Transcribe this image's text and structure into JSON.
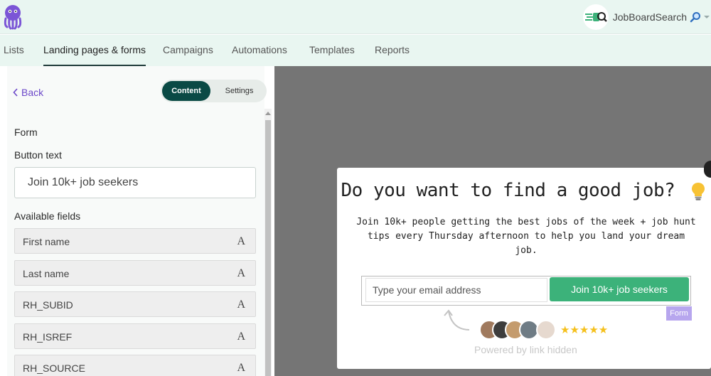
{
  "account": {
    "name": "JobBoardSearch"
  },
  "nav": {
    "tabs": [
      "Lists",
      "Landing pages & forms",
      "Campaigns",
      "Automations",
      "Templates",
      "Reports"
    ],
    "active": "Landing pages & forms"
  },
  "panel": {
    "back_label": "Back",
    "toggle": {
      "content": "Content",
      "settings": "Settings",
      "selected": "Content"
    },
    "form_heading": "Form",
    "button_text_label": "Button text",
    "button_text_value": "Join 10k+ job seekers",
    "available_fields_label": "Available fields",
    "fields": [
      {
        "label": "First name",
        "type_glyph": "A"
      },
      {
        "label": "Last name",
        "type_glyph": "A"
      },
      {
        "label": "RH_SUBID",
        "type_glyph": "A"
      },
      {
        "label": "RH_ISREF",
        "type_glyph": "A"
      },
      {
        "label": "RH_SOURCE",
        "type_glyph": "A"
      }
    ]
  },
  "preview": {
    "title": "Do you want to find a good job?",
    "title_icon": "lightbulb-icon",
    "subtitle": "Join 10k+ people getting the best jobs of the week + job hunt tips every Thursday afternoon to help you land your dream job.",
    "email_placeholder": "Type your email address",
    "submit_label": "Join 10k+ job seekers",
    "form_tag": "Form",
    "rating_stars": "★★★★★",
    "powered_by": "Powered by link hidden"
  },
  "colors": {
    "topbar_bg": "#e9f6f1",
    "toggle_active_bg": "#0a4a45",
    "back_link": "#6b47c9",
    "submit_bg": "#3cb27a",
    "preview_bg": "#757575",
    "form_tag_bg": "#b7a6ee"
  }
}
